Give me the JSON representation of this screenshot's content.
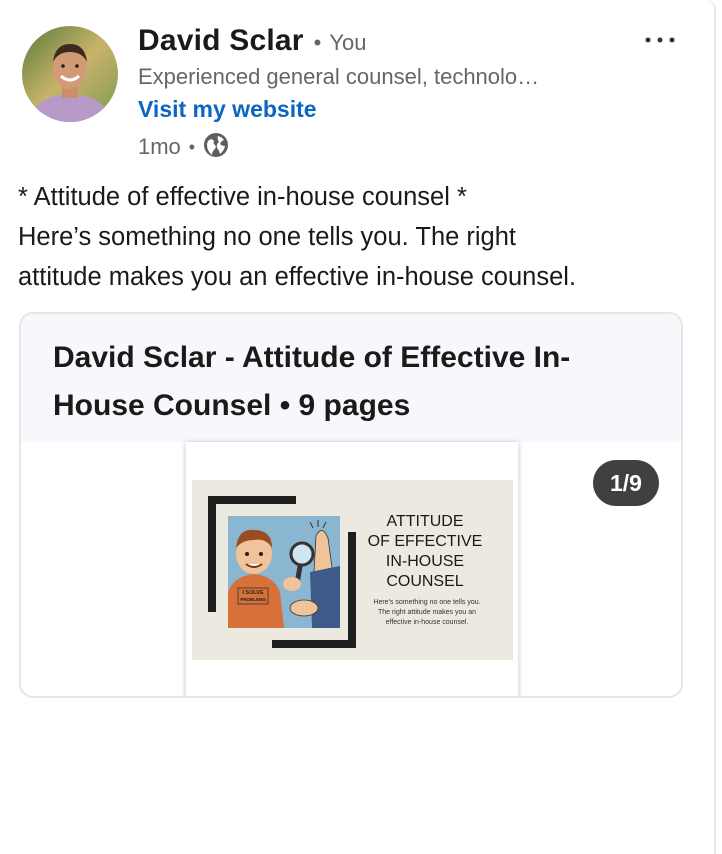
{
  "author": {
    "name": "David Sclar",
    "relation": "You",
    "headline": "Experienced general counsel, technolo…",
    "website_label": "Visit my website",
    "time": "1mo",
    "visibility_icon": "globe-icon"
  },
  "post": {
    "lines": [
      "* Attitude of effective in-house counsel *",
      "Here’s something no one tells you. The right",
      "attitude makes you an effective in-house counsel."
    ]
  },
  "document": {
    "title": "David Sclar - Attitude of Effective In-House Counsel • 9 pages",
    "page_counter": "1/9",
    "slide": {
      "title_lines": [
        "ATTITUDE",
        "OF EFFECTIVE",
        "IN-HOUSE",
        "COUNSEL"
      ],
      "subtitle_lines": [
        "Here's something no one tells you.",
        "The right attitude makes you an",
        "effective in-house counsel."
      ],
      "shirt_text_lines": [
        "I SOLVE",
        "PROBLEMS"
      ]
    }
  },
  "colors": {
    "link": "#0a66c2",
    "muted": "#666666",
    "card_title_bg": "#f6f8fc",
    "counter_bg": "#404040"
  }
}
